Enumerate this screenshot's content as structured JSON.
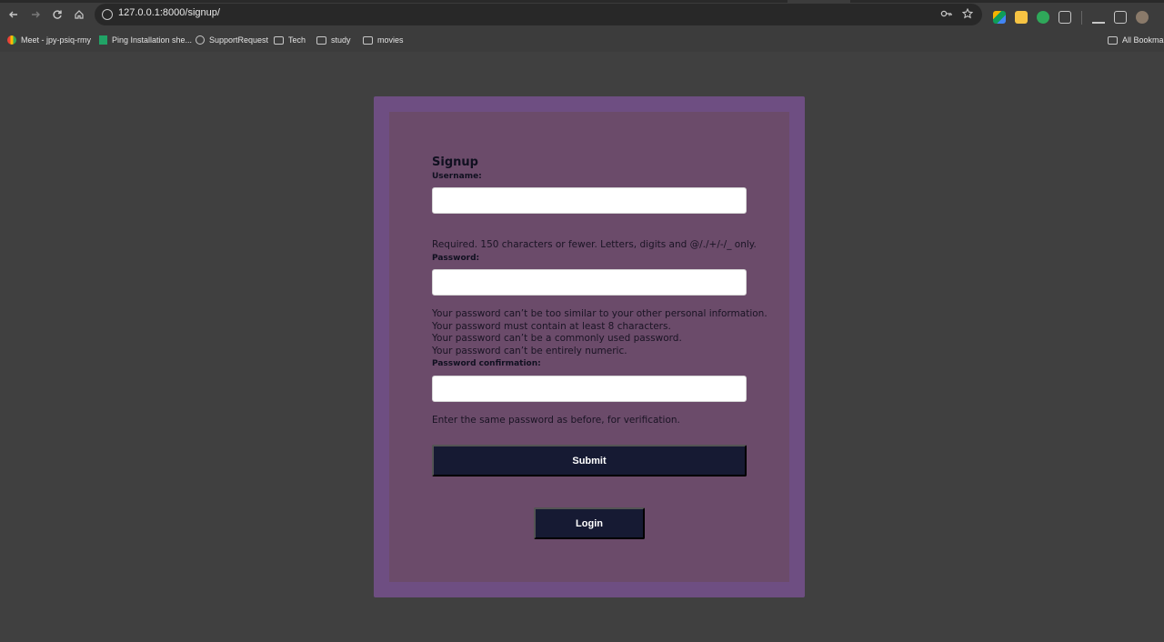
{
  "browser": {
    "url": "127.0.0.1:8000/signup/",
    "bookmarks": [
      {
        "label": "Meet - jpy-psiq-rmy"
      },
      {
        "label": "Ping Installation she..."
      },
      {
        "label": "SupportRequest"
      },
      {
        "label": "Tech"
      },
      {
        "label": "study"
      },
      {
        "label": "movies"
      }
    ],
    "all_bookmarks": "All Bookmarks"
  },
  "form": {
    "title": "Signup",
    "username_label": "Username:",
    "username_value": "",
    "username_help": "Required. 150 characters or fewer. Letters, digits and @/./+/-/_ only.",
    "password_label": "Password:",
    "password_value": "",
    "password_help": [
      "Your password can’t be too similar to your other personal information.",
      "Your password must contain at least 8 characters.",
      "Your password can’t be a commonly used password.",
      "Your password can’t be entirely numeric."
    ],
    "password_confirm_label": "Password confirmation:",
    "password_confirm_value": "",
    "password_confirm_help": "Enter the same password as before, for verification.",
    "submit_label": "Submit",
    "login_label": "Login"
  },
  "colors": {
    "page_bg": "#404040",
    "card_outer": "#6e4e82",
    "card_inner": "#6b4b6a",
    "button_bg": "#161a33"
  }
}
